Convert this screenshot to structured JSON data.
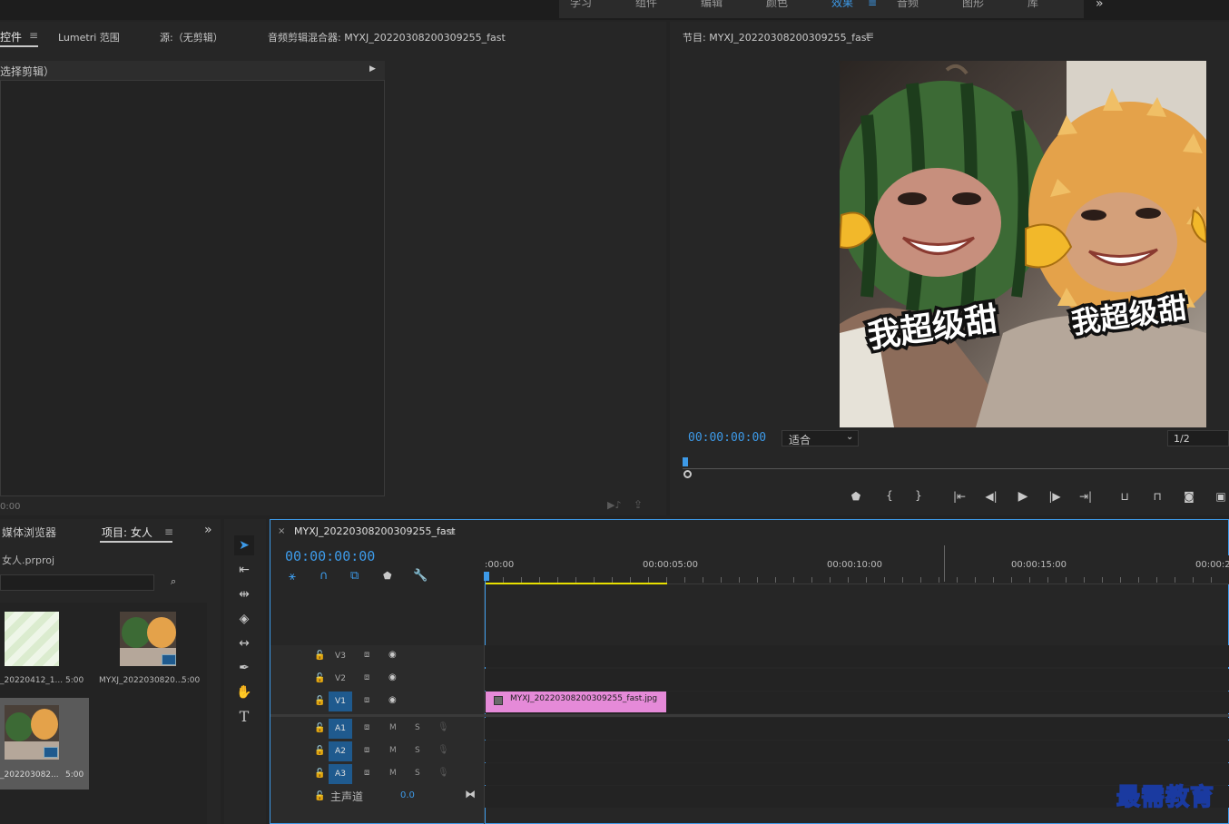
{
  "workspaces": [
    "学习",
    "组件",
    "编辑",
    "颜色",
    "效果",
    "音频",
    "图形",
    "库"
  ],
  "workspace_active": "效果",
  "more": "»",
  "source_panel": {
    "tabs": [
      "控件",
      "Lumetri 范围",
      "源:（无剪辑）",
      "音频剪辑混合器: MYXJ_20220308200309255_fast"
    ],
    "no_clip": "选择剪辑）",
    "timecode": "0:00"
  },
  "program_panel": {
    "title": "节目: MYXJ_20220308200309255_fast",
    "timecode": "00:00:00:00",
    "fit": "适合",
    "resolution": "1/2",
    "image_caption": "我超级甜"
  },
  "project_panel": {
    "tabs": [
      "媒体浏览器",
      "项目: 女人"
    ],
    "file": "女人.prproj",
    "items": [
      {
        "name": "_20220412_1...",
        "dur": "5:00"
      },
      {
        "name": "MYXJ_2022030820...",
        "dur": "5:00"
      },
      {
        "name": "_202203082...",
        "dur": "5:00"
      }
    ]
  },
  "timeline": {
    "tab": "MYXJ_20220308200309255_fast",
    "timecode": "00:00:00:00",
    "ruler": [
      ":00:00",
      "00:00:05:00",
      "00:00:10:00",
      "00:00:15:00",
      "00:00:2"
    ],
    "video_tracks": [
      "V3",
      "V2",
      "V1"
    ],
    "audio_tracks": [
      "A1",
      "A2",
      "A3"
    ],
    "master": "主声道",
    "master_value": "0.0",
    "clip_name": "MYXJ_20220308200309255_fast.jpg",
    "m_label": "M",
    "s_label": "S"
  },
  "watermark": "最需教育",
  "colors": {
    "accent": "#3d9ae8",
    "clip": "#e58ad8",
    "track_on": "#1f5a8e",
    "work_area": "#e8e000"
  }
}
